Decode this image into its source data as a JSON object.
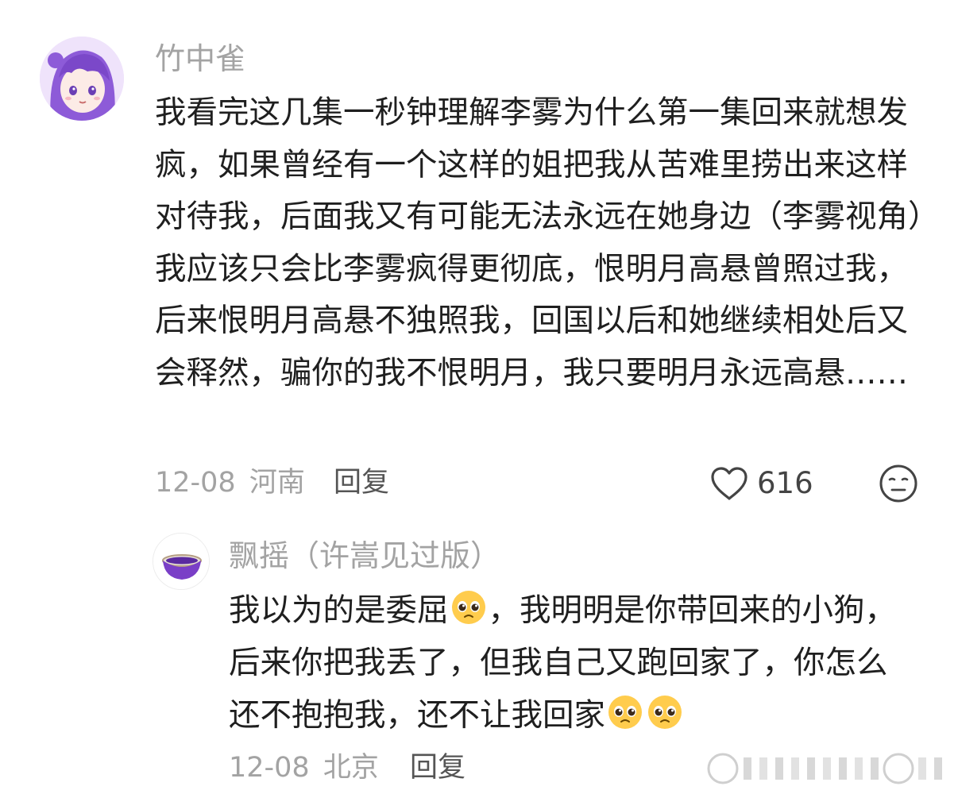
{
  "comments": [
    {
      "username": "竹中雀",
      "text": "我看完这几集一秒钟理解李雾为什么第一集回来就想发疯，如果曾经有一个这样的姐把我从苦难里捞出来这样对待我，后面我又有可能无法永远在她身边（李雾视角）我应该只会比李雾疯得更彻底，恨明月高悬曾照过我，后来恨明月高悬不独照我，回国以后和她继续相处后又会释然，骗你的我不恨明月，我只要明月永远高悬……",
      "date": "12-08",
      "location": "河南",
      "reply_label": "回复",
      "likes": "616"
    },
    {
      "username": "飘摇（许嵩见过版）",
      "text_part1": "我以为的是委屈",
      "text_part2": "，我明明是你带回来的小狗，后来你把我丢了，但我自己又跑回家了，你怎么还不抱抱我，还不让我回家",
      "date": "12-08",
      "location": "北京",
      "reply_label": "回复"
    }
  ],
  "icons": {
    "like": "heart-outline-icon",
    "reaction": "neutral-face-icon",
    "emoji": "pleading-face-emoji"
  },
  "colors": {
    "text": "#1f1f1f",
    "muted": "#a3a3a3",
    "avatar_purple": "#8a55d6"
  }
}
